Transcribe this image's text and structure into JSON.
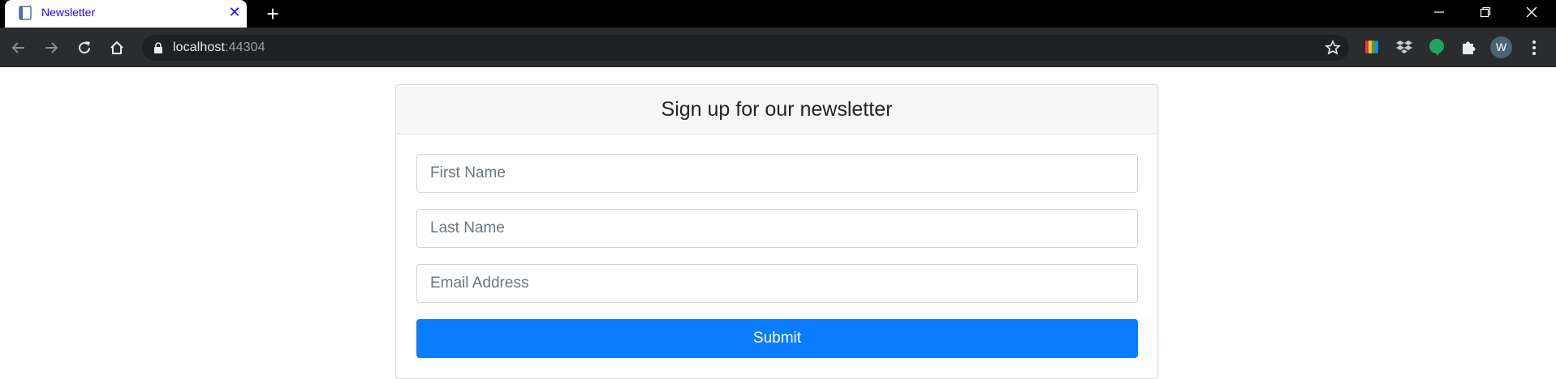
{
  "browser": {
    "tab": {
      "title": "Newsletter",
      "favicon": "document-icon"
    },
    "new_tab": "+",
    "address": {
      "host": "localhost",
      "port": ":44304"
    }
  },
  "form": {
    "title": "Sign up for our newsletter",
    "fields": [
      {
        "placeholder": "First Name",
        "value": ""
      },
      {
        "placeholder": "Last Name",
        "value": ""
      },
      {
        "placeholder": "Email Address",
        "value": ""
      }
    ],
    "submit_label": "Submit"
  },
  "profile": {
    "initial": "W"
  },
  "colors": {
    "accent": "#0a7cff",
    "tab_title": "#1a0dff",
    "toolbar": "#2b2c2e"
  }
}
